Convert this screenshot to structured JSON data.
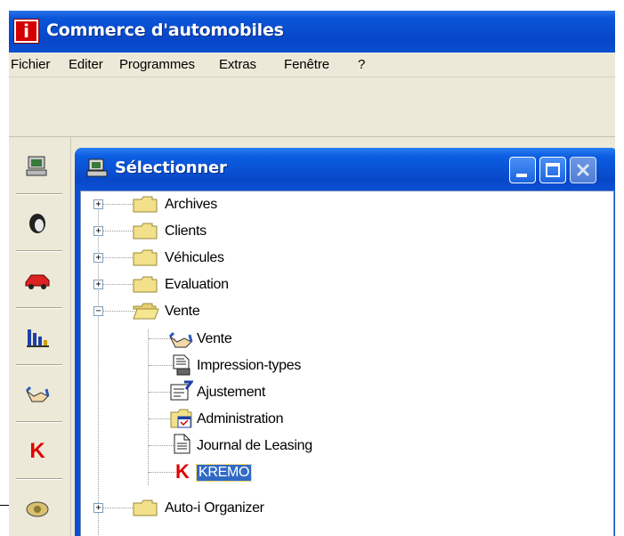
{
  "app": {
    "icon_letter": "i",
    "title": "Commerce d'automobiles"
  },
  "menu": [
    "Fichier",
    "Editer",
    "Programmes",
    "Extras",
    "Fenêtre",
    "?"
  ],
  "left_toolbar": [
    {
      "icon": "computer-icon"
    },
    {
      "icon": "client-head-icon"
    },
    {
      "icon": "car-icon"
    },
    {
      "icon": "bar-chart-icon"
    },
    {
      "icon": "handshake-icon"
    },
    {
      "icon": "kremo-k-icon",
      "letter": "K"
    },
    {
      "icon": "phone-icon"
    }
  ],
  "child_window": {
    "title": "Sélectionner"
  },
  "tree": {
    "top_items": [
      {
        "label": "Archives",
        "expanded": false
      },
      {
        "label": "Clients",
        "expanded": false
      },
      {
        "label": "Véhicules",
        "expanded": false
      },
      {
        "label": "Evaluation",
        "expanded": false
      },
      {
        "label": "Vente",
        "expanded": true
      }
    ],
    "vente_children": [
      {
        "label": "Vente",
        "icon": "handshake-icon"
      },
      {
        "label": "Impression-types",
        "icon": "print-document-icon"
      },
      {
        "label": "Ajustement",
        "icon": "adjust-form-icon"
      },
      {
        "label": "Administration",
        "icon": "admin-folder-icon"
      },
      {
        "label": "Journal de Leasing",
        "icon": "document-icon"
      },
      {
        "label": "KREMO",
        "icon": "kremo-k-icon",
        "selected": true,
        "letter": "K"
      }
    ],
    "after_items": [
      {
        "label": "Auto-i Organizer",
        "expanded": false
      }
    ]
  },
  "colors": {
    "titlebar": "#0a4fd2",
    "selection": "#316ac5",
    "kremo_red": "#e00000"
  }
}
